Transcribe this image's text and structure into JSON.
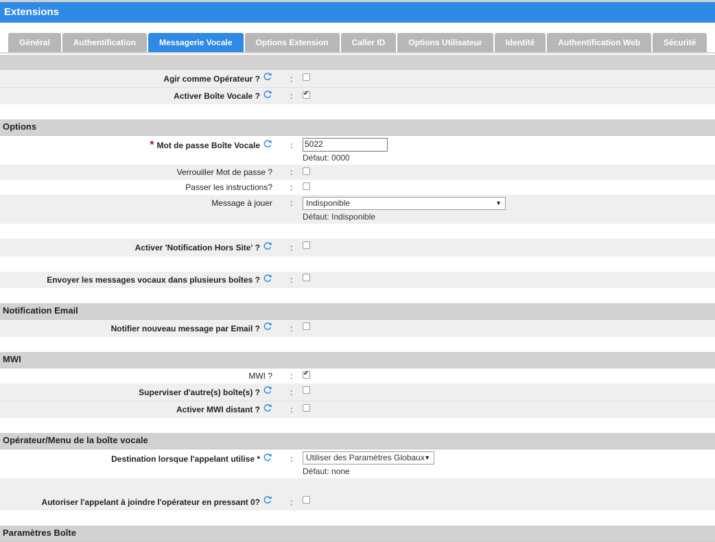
{
  "header": {
    "title": "Extensions"
  },
  "tabs": [
    "Général",
    "Authentification",
    "Messagerie Vocale",
    "Options Extension",
    "Caller ID",
    "Options Utilisateur",
    "Identité",
    "Authentification Web",
    "Sécurité"
  ],
  "active_tab": "Messagerie Vocale",
  "fields": {
    "operator": {
      "label": "Agir comme Opérateur ?",
      "checked": false
    },
    "voicemail": {
      "label": "Activer Boîte Vocale ?",
      "checked": true
    },
    "password": {
      "label": "Mot de passe Boîte Vocale",
      "value": "5022",
      "default": "Défaut: 0000"
    },
    "lock_password": {
      "label": "Verrouiller Mot de passe ?",
      "checked": false
    },
    "skip_instructions": {
      "label": "Passer les instructions?",
      "checked": false
    },
    "message": {
      "label": "Message à jouer",
      "selected": "Indisponible",
      "default": "Défaut: Indisponible"
    },
    "offsite": {
      "label": "Activer 'Notification Hors Site' ?",
      "checked": false
    },
    "multi_box": {
      "label": "Envoyer les messages vocaux dans plusieurs boîtes ?",
      "checked": false
    },
    "email_notify": {
      "label": "Notifier nouveau message par Email ?",
      "checked": false
    },
    "mwi": {
      "label": "MWI ?",
      "checked": true
    },
    "supervise": {
      "label": "Superviser d'autre(s) boîte(s) ?",
      "checked": false
    },
    "remote_mwi": {
      "label": "Activer MWI distant ?",
      "checked": false
    },
    "destination": {
      "label": "Destination lorsque l'appelant utilise *",
      "selected": "Utiliser des Paramètres Globaux",
      "default": "Défaut: none"
    },
    "operator_zero": {
      "label": "Autoriser l'appelant à joindre l'opérateur en pressant 0?",
      "checked": false
    }
  },
  "sections": {
    "options": "Options",
    "email": "Notification Email",
    "mwi": "MWI",
    "operator_menu": "Opérateur/Menu de la boîte vocale",
    "box_params": "Paramètres Boîte"
  },
  "colon": ":",
  "colors": {
    "accent": "#2f8ae5",
    "tab_inactive": "#b7b7b7",
    "section_bg": "#d2d2d2",
    "required_star": "#9b1b1b"
  },
  "icons": {
    "reset": "refresh-icon",
    "required": "asterisk"
  }
}
